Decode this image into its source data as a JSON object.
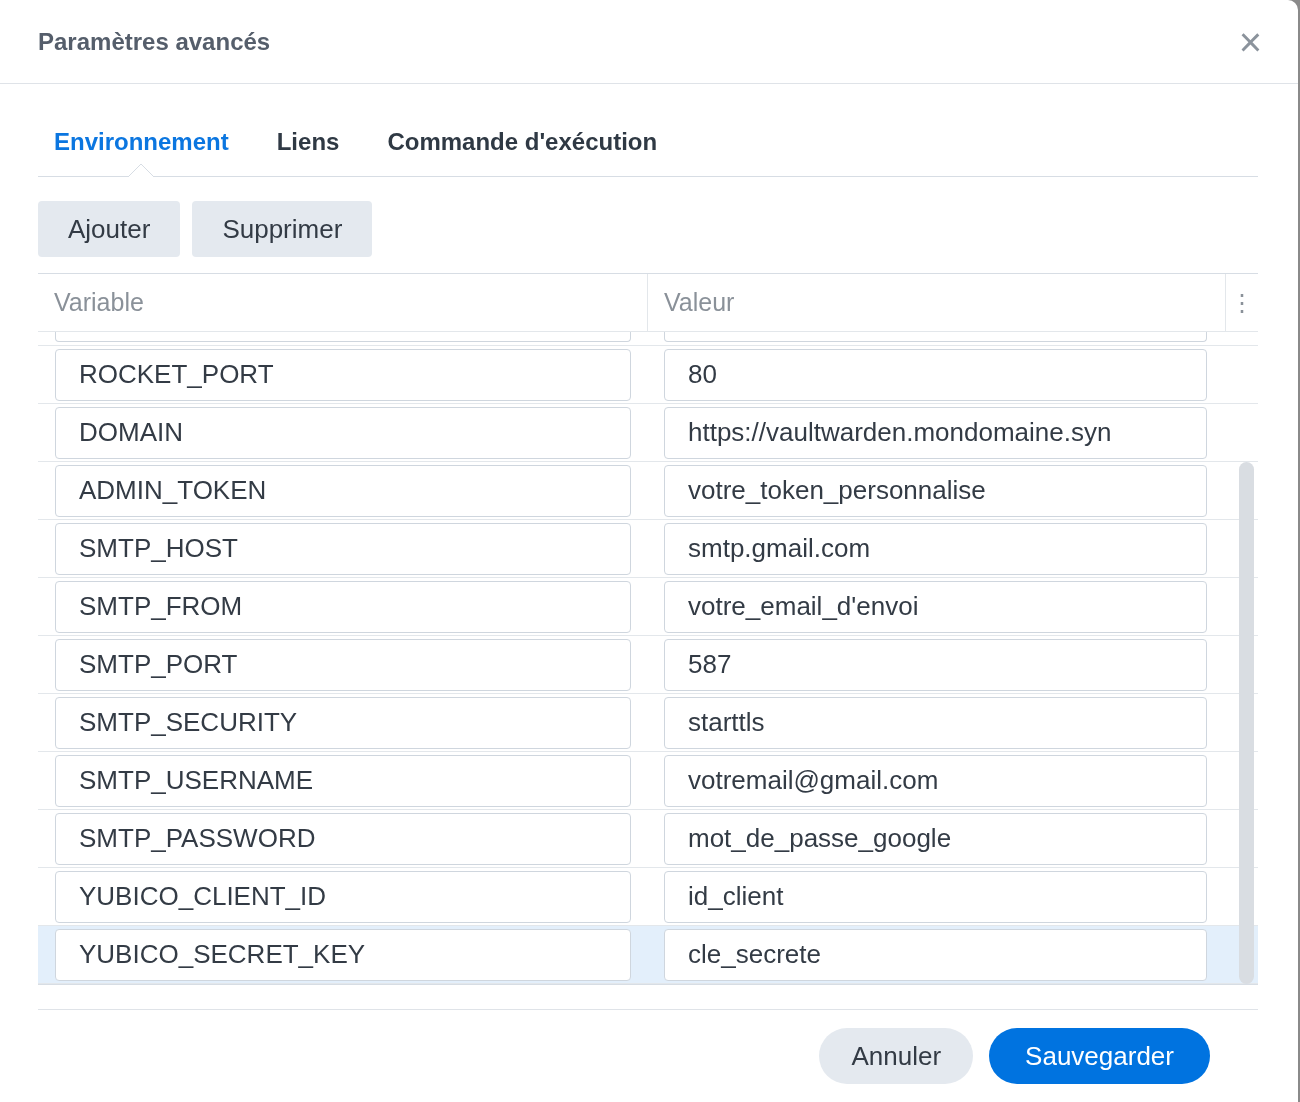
{
  "dialog": {
    "title": "Paramètres avancés",
    "close": "×"
  },
  "tabs": [
    {
      "label": "Environnement",
      "selected": true
    },
    {
      "label": "Liens",
      "selected": false
    },
    {
      "label": "Commande d'exécution",
      "selected": false
    }
  ],
  "toolbar": [
    "Ajouter",
    "Supprimer"
  ],
  "table": {
    "columns": [
      "Variable",
      "Valeur"
    ],
    "menu": "⋮",
    "rows": [
      {
        "variable": "ROCKET_PORT",
        "value": "80",
        "selected": false
      },
      {
        "variable": "DOMAIN",
        "value": "https://vaultwarden.mondomaine.syn",
        "selected": false
      },
      {
        "variable": "ADMIN_TOKEN",
        "value": "votre_token_personnalise",
        "selected": false
      },
      {
        "variable": "SMTP_HOST",
        "value": "smtp.gmail.com",
        "selected": false
      },
      {
        "variable": "SMTP_FROM",
        "value": "votre_email_d'envoi",
        "selected": false
      },
      {
        "variable": "SMTP_PORT",
        "value": "587",
        "selected": false
      },
      {
        "variable": "SMTP_SECURITY",
        "value": "starttls",
        "selected": false
      },
      {
        "variable": "SMTP_USERNAME",
        "value": "votremail@gmail.com",
        "selected": false
      },
      {
        "variable": "SMTP_PASSWORD",
        "value": "mot_de_passe_google",
        "selected": false
      },
      {
        "variable": "YUBICO_CLIENT_ID",
        "value": "id_client",
        "selected": false
      },
      {
        "variable": "YUBICO_SECRET_KEY",
        "value": "cle_secrete",
        "selected": true
      }
    ]
  },
  "footer": [
    {
      "label": "Annuler",
      "kind": "secondary"
    },
    {
      "label": "Sauvegarder",
      "kind": "primary"
    }
  ]
}
